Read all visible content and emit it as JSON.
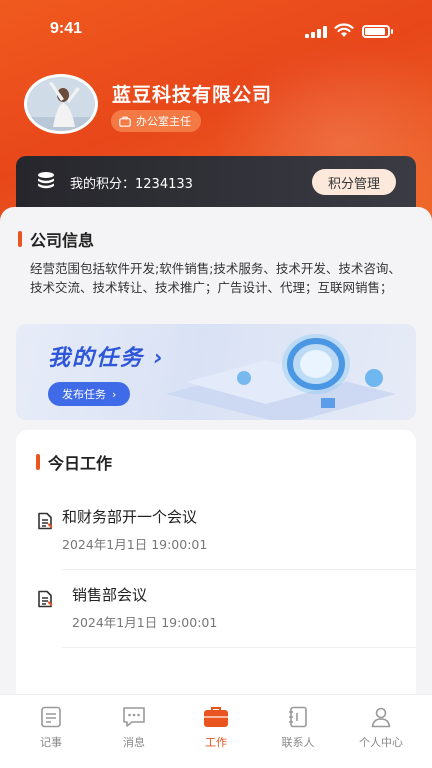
{
  "status": {
    "time": "9:41"
  },
  "profile": {
    "company": "蓝豆科技有限公司",
    "role": "办公室主任"
  },
  "points": {
    "label": "我的积分：",
    "value": "1234133",
    "manage_button": "积分管理"
  },
  "company_info": {
    "title": "公司信息",
    "description": "经营范围包括软件开发;软件销售;技术服务、技术开发、技术咨询、技术交流、技术转让、技术推广；广告设计、代理；互联网销售；"
  },
  "banner": {
    "title": "我的任务",
    "button": "发布任务"
  },
  "today": {
    "title": "今日工作",
    "items": [
      {
        "title": "和财务部开一个会议",
        "time": "2024年1月1日 19:00:01"
      },
      {
        "title": "销售部会议",
        "time": "2024年1月1日 19:00:01"
      }
    ]
  },
  "tabs": [
    {
      "label": "记事",
      "icon": "notes-icon"
    },
    {
      "label": "消息",
      "icon": "message-icon"
    },
    {
      "label": "工作",
      "icon": "briefcase-icon"
    },
    {
      "label": "联系人",
      "icon": "contacts-icon"
    },
    {
      "label": "个人中心",
      "icon": "person-icon"
    }
  ],
  "colors": {
    "accent": "#e9541f",
    "banner_blue": "#3f6ae8"
  }
}
